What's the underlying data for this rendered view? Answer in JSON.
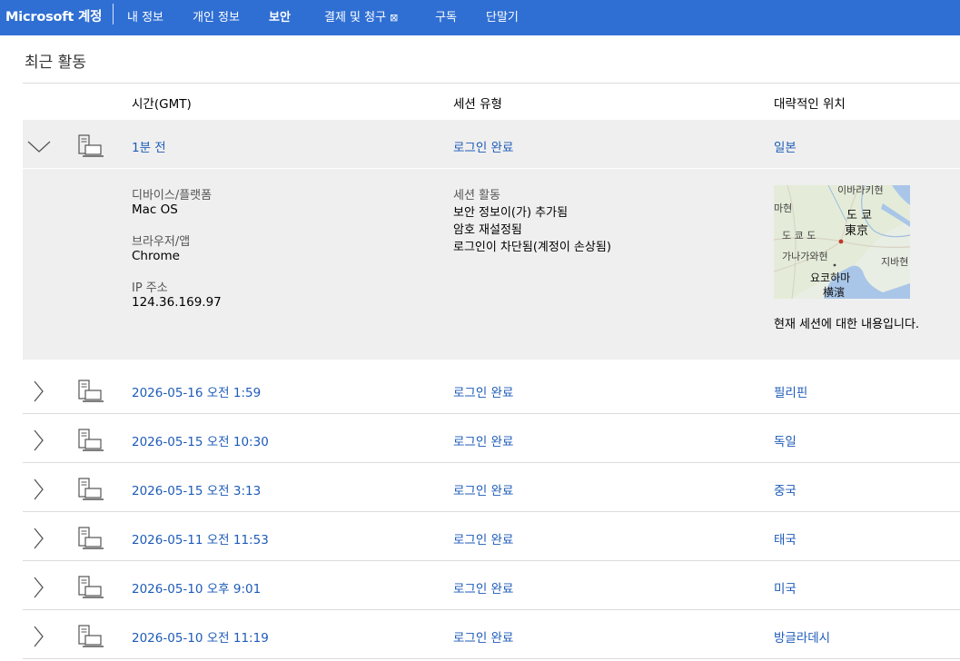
{
  "nav": {
    "brand": "Microsoft 계정",
    "items": [
      {
        "label": "내 정보"
      },
      {
        "label": "개인 정보"
      },
      {
        "label": "보안"
      },
      {
        "label": "결제 및 청구"
      },
      {
        "label": "구독"
      },
      {
        "label": "단말기"
      }
    ],
    "external_icon": "⊠",
    "active": "보안"
  },
  "page": {
    "title": "최근 활동"
  },
  "table": {
    "headers": {
      "time": "시간(GMT)",
      "session_type": "세션 유형",
      "location": "대략적인 위치"
    },
    "rows": [
      {
        "time": "1분 전",
        "session": "로그인 완료",
        "location": "일본",
        "expanded": true
      },
      {
        "time": "2026-05-16 오전 1:59",
        "session": "로그인 완료",
        "location": "필리핀"
      },
      {
        "time": "2026-05-15 오전 10:30",
        "session": "로그인 완료",
        "location": "독일"
      },
      {
        "time": "2026-05-15 오전 3:13",
        "session": "로그인 완료",
        "location": "중국"
      },
      {
        "time": "2026-05-11 오전 11:53",
        "session": "로그인 완료",
        "location": "태국"
      },
      {
        "time": "2026-05-10 오후 9:01",
        "session": "로그인 완료",
        "location": "미국"
      },
      {
        "time": "2026-05-10 오전 11:19",
        "session": "로그인 완료",
        "location": "방글라데시"
      }
    ]
  },
  "detail": {
    "device_label": "디바이스/플랫폼",
    "device_value": "Mac OS",
    "browser_label": "브라우저/앱",
    "browser_value": "Chrome",
    "ip_label": "IP 주소",
    "ip_value": "124.36.169.97",
    "activity_label": "세션 활동",
    "activities": [
      "보안 정보이(가) 추가됨",
      "암호 재설정됨",
      "로그인이 차단됨(계정이 손상됨)"
    ],
    "map_labels": {
      "ibaraki": "이바라키현",
      "tokyo_ko": "도 쿄",
      "tokyo_ja": "東京",
      "machida": "마현",
      "tokyo_to": "도 쿄 도",
      "kanagawa": "가나가와현",
      "yokohama_ko": "요코하마",
      "yokohama_ja": "横濱",
      "chiba": "지바현"
    },
    "current_session_note": "현재 세션에 대한 내용입니다."
  },
  "colors": {
    "nav_bg": "#2f6fd3",
    "link": "#1d5bb8",
    "selected_bg": "#efefef"
  }
}
